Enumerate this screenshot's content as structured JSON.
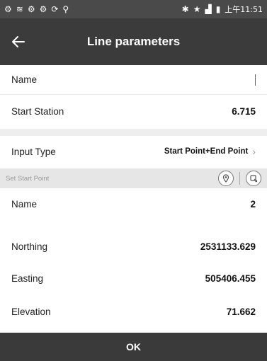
{
  "status_bar": {
    "time": "上午11:51",
    "left_icons": [
      "settings-icon",
      "wifi-icon",
      "settings-icon",
      "settings-icon",
      "sync-icon",
      "location-icon"
    ],
    "right_icons": [
      "bluetooth-icon",
      "star-icon",
      "signal-icon",
      "battery-icon"
    ]
  },
  "app_bar": {
    "title": "Line parameters",
    "back_icon": "arrow-left-icon"
  },
  "fields": {
    "name_label": "Name",
    "name_value": "",
    "start_station_label": "Start Station",
    "start_station_value": "6.715",
    "input_type_label": "Input Type",
    "input_type_value": "Start Point+End Point"
  },
  "section": {
    "title": "Set Start Point",
    "tool_icons": [
      "map-pin-icon",
      "import-icon"
    ]
  },
  "point": {
    "name_label": "Name",
    "name_value": "2",
    "northing_label": "Northing",
    "northing_value": "2531133.629",
    "easting_label": "Easting",
    "easting_value": "505406.455",
    "elevation_label": "Elevation",
    "elevation_value": "71.662"
  },
  "footer": {
    "ok_label": "OK"
  },
  "colors": {
    "status_bar": "#4a4a4a",
    "app_bar": "#3b3b3b",
    "section_bg": "#e6e6e6",
    "footer": "#3a3a3a"
  }
}
